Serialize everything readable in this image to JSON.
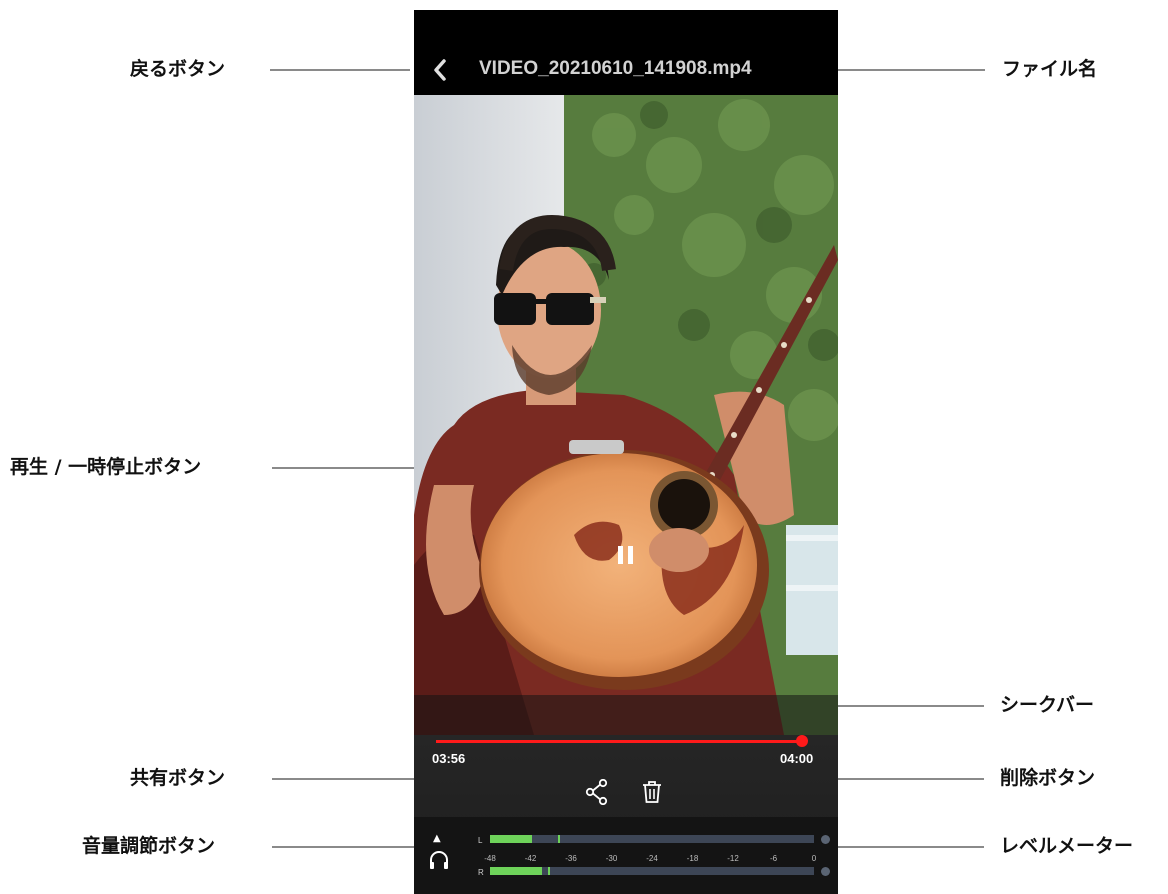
{
  "annotations": {
    "back": "戻るボタン",
    "filename": "ファイル名",
    "play_pause": "再生 / 一時停止ボタン",
    "seekbar": "シークバー",
    "share": "共有ボタン",
    "delete": "削除ボタン",
    "volume": "音量調節ボタン",
    "level_meter": "レベルメーター"
  },
  "player": {
    "file_name": "VIDEO_20210610_141908.mp4",
    "seek": {
      "current": "03:56",
      "total": "04:00",
      "progress": 0.983
    },
    "meter": {
      "left_label": "L",
      "right_label": "R",
      "left_level": 0.13,
      "left_peak": 0.21,
      "right_level": 0.16,
      "right_peak": 0.18,
      "scale": [
        "-48",
        "-42",
        "-36",
        "-30",
        "-24",
        "-18",
        "-12",
        "-6",
        "0"
      ]
    },
    "icons": [
      "back-chevron-icon",
      "pause-icon",
      "share-icon",
      "trash-icon",
      "volume-up-icon",
      "headphone-icon"
    ],
    "colors": {
      "seek": "#ff1a1a",
      "meter_fill": "#6ed35a",
      "meter_track": "#3d4656"
    }
  }
}
